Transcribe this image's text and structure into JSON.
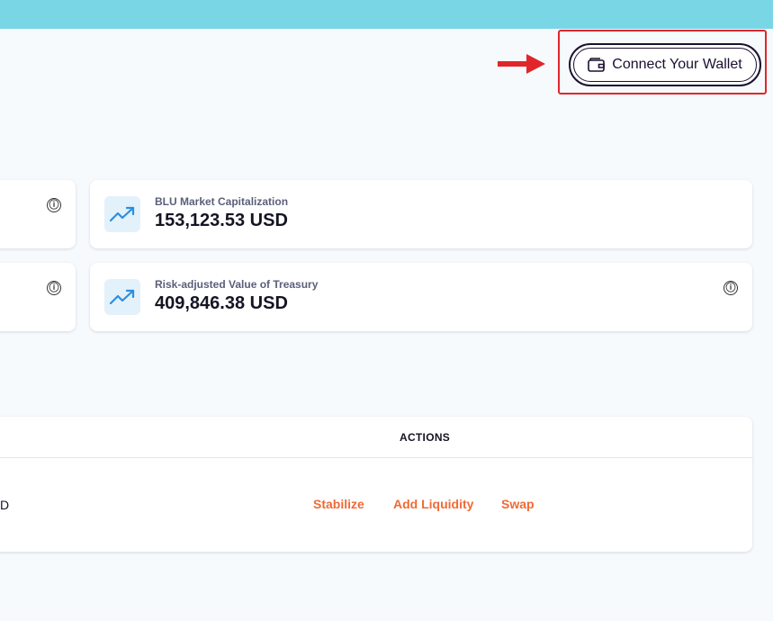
{
  "header": {
    "connect_wallet_label": "Connect Your Wallet"
  },
  "stats": [
    {
      "label": "BLU Market Capitalization",
      "value": "153,123.53 USD",
      "icon": "trending-up-icon"
    },
    {
      "label": "Risk-adjusted Value of Treasury",
      "value": "409,846.38 USD",
      "icon": "trending-up-icon"
    }
  ],
  "info_glyph": "ⓘ",
  "table": {
    "columns": [
      "ACTIONS"
    ],
    "rows": [
      {
        "partial_cell": "D",
        "actions": [
          "Stabilize",
          "Add Liquidity",
          "Swap"
        ]
      }
    ]
  },
  "colors": {
    "topbar": "#79d6e5",
    "accent_action": "#ef6a35",
    "annotation": "#e0262b",
    "wallet_border": "#1b1030"
  }
}
